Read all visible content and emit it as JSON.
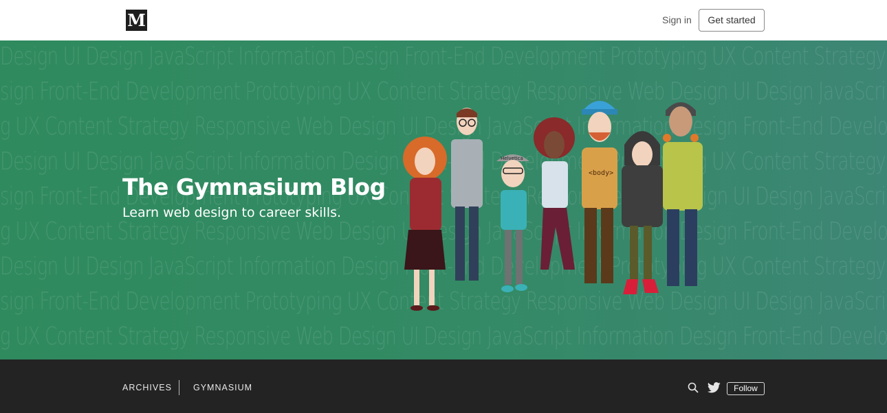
{
  "header": {
    "logo_letter": "M",
    "sign_in": "Sign in",
    "get_started": "Get started"
  },
  "hero": {
    "title": "The Gymnasium Blog",
    "subtitle": "Learn web design to career skills.",
    "background_words": [
      "Design    UI Design    JavaScript    Information Design    Front-End Development    Prototyping    UX    Content Strategy    Responsive Web Design",
      "sign    Front-End Development    Prototyping    UX    Content Strategy    Responsive Web Design    UI Design    JavaScript    Information Design",
      "g    UX    Content Strategy    Responsive Web Design    UI Design    JavaScript    Information Design    Front-End Development    Prototyping",
      "Design    UI Design    JavaScript    Information Design    Front-End Development    Prototyping    UX    Content Strategy    Responsive Web Design",
      "sign    Front-End Development    Prototyping    UX    Content Strategy    Responsive Web Design    UI Design    JavaScript    Information Design",
      "g    UX    Content Strategy    Responsive Web Design    UI Design    JavaScript    Information Design    Front-End Development    Prototyping",
      "Design    UI Design    JavaScript    Information Design    Front-End Development    Prototyping    UX    Content Strategy    Responsive Web Design",
      "sign    Front-End Development    Prototyping    UX    Content Strategy    Responsive Web Design    UI Design    JavaScript    Information Design",
      "g    UX    Content Strategy    Responsive Web Design    UI Design    JavaScript    Information Design    Front-End Development    Prototyping"
    ],
    "illustration_labels": {
      "cap_text": "Helvetica",
      "shirt_text": "<body>"
    },
    "colors": {
      "gradient_start": "#2f8a5e",
      "gradient_end": "#3d8675"
    }
  },
  "nav": {
    "archives": "ARCHIVES",
    "gymnasium": "GYMNASIUM",
    "follow": "Follow",
    "icons": [
      "search-icon",
      "twitter-icon"
    ]
  }
}
